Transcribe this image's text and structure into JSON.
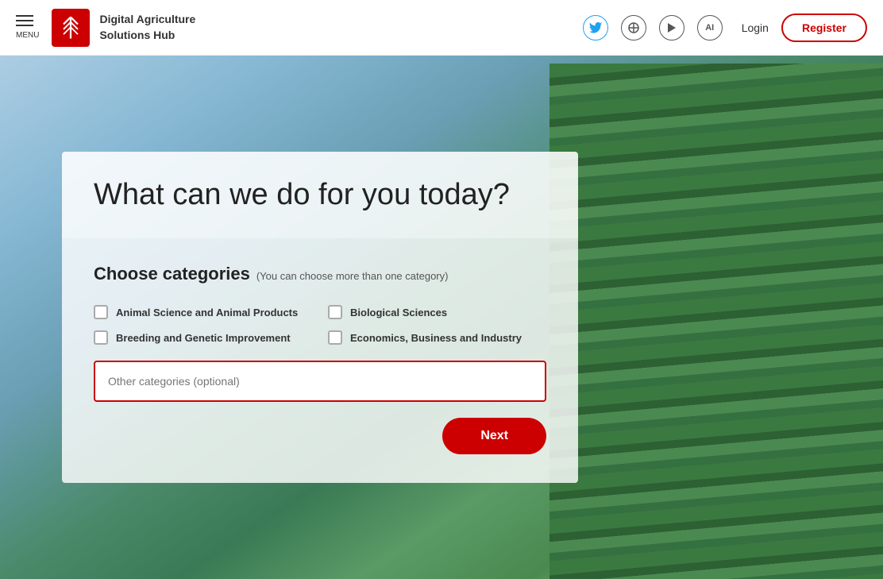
{
  "header": {
    "menu_label": "MENU",
    "logo_alt": "Digital Agriculture Solutions Hub Logo",
    "site_name_line1": "Digital Agriculture",
    "site_name_line2": "Solutions Hub",
    "login_label": "Login",
    "register_label": "Register",
    "icons": {
      "twitter": "𝕏",
      "circle_icon": "●",
      "play": "▶",
      "ai": "AI"
    }
  },
  "hero": {
    "question": "What can we do for you today?"
  },
  "categories_form": {
    "title": "Choose categories",
    "subtitle": "(You can choose more than one category)",
    "options": [
      {
        "id": "animal-science",
        "label": "Animal Science and Animal Products",
        "checked": false
      },
      {
        "id": "biological-sciences",
        "label": "Biological Sciences",
        "checked": false
      },
      {
        "id": "breeding-genetic",
        "label": "Breeding and Genetic Improvement",
        "checked": false
      },
      {
        "id": "economics-business",
        "label": "Economics, Business and Industry",
        "checked": false
      }
    ],
    "other_placeholder": "Other categories (optional)",
    "next_label": "Next"
  }
}
